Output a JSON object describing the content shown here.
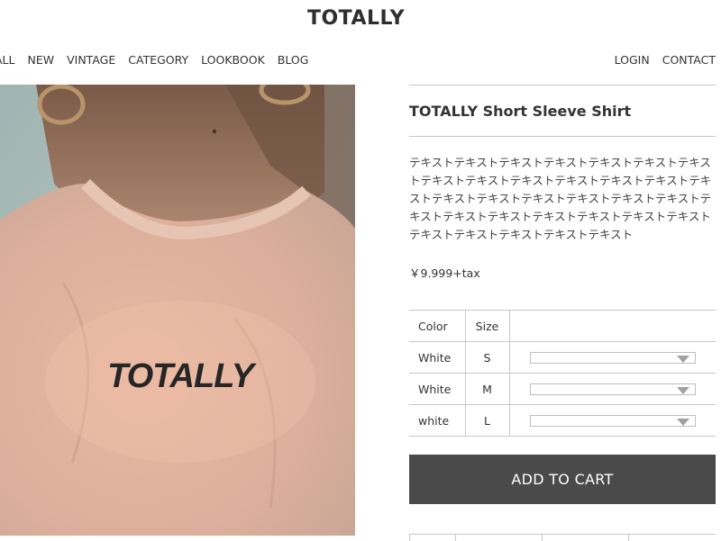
{
  "brand": {
    "logo": "TOTALLY"
  },
  "nav": {
    "left": [
      "ALL",
      "NEW",
      "VINTAGE",
      "CATEGORY",
      "LOOKBOOK",
      "BLOG"
    ],
    "right": [
      "LOGIN",
      "CONTACT"
    ]
  },
  "product": {
    "shirt_print": "TOTALLY",
    "title": "TOTALLY Short Sleeve Shirt",
    "description": "テキストテキストテキストテキストテキストテキストテキストテキストテキストテキストテキストテキストテキストテキストテキストテキストテキストテキストテキストテキストテキストテキストテキストテキストテキストテキストテキストテキストテキストテキストテキストテキスト",
    "price": "￥9.999+tax"
  },
  "options": {
    "headers": {
      "color": "Color",
      "size": "Size"
    },
    "rows": [
      {
        "color": "White",
        "size": "S"
      },
      {
        "color": "White",
        "size": "M"
      },
      {
        "color": "white",
        "size": "L"
      }
    ]
  },
  "cart": {
    "label": "ADD TO CART"
  },
  "colors": {
    "button_bg": "#4a4a4a",
    "rule": "#c8c8c8"
  }
}
